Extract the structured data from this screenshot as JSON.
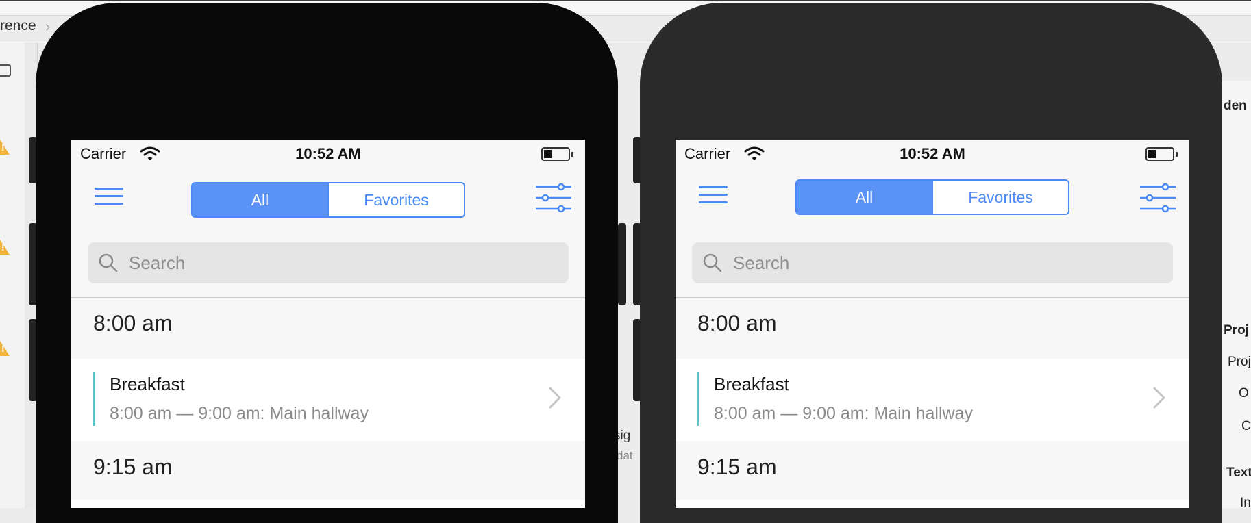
{
  "xcode": {
    "breadcrumb_text": "rence",
    "right_panel": {
      "items": [
        "den",
        "Proj",
        "Proj",
        "O",
        "C",
        "Text",
        "In"
      ]
    },
    "mid_text": {
      "line1": "sig",
      "line2": "dat"
    }
  },
  "phones": [
    {
      "status": {
        "carrier": "Carrier",
        "time": "10:52 AM"
      },
      "segmented": {
        "all_label": "All",
        "favorites_label": "Favorites",
        "selected": "All"
      },
      "search": {
        "placeholder": "Search"
      },
      "sections": [
        {
          "time": "8:00 am",
          "events": [
            {
              "title": "Breakfast",
              "detail": "8:00 am — 9:00 am: Main hallway"
            }
          ]
        },
        {
          "time": "9:15 am",
          "events": []
        }
      ]
    },
    {
      "status": {
        "carrier": "Carrier",
        "time": "10:52 AM"
      },
      "segmented": {
        "all_label": "All",
        "favorites_label": "Favorites",
        "selected": "All"
      },
      "search": {
        "placeholder": "Search"
      },
      "sections": [
        {
          "time": "8:00 am",
          "events": [
            {
              "title": "Breakfast",
              "detail": "8:00 am — 9:00 am: Main hallway"
            }
          ]
        },
        {
          "time": "9:15 am",
          "events": []
        }
      ]
    }
  ],
  "colors": {
    "accent": "#4c8bf5",
    "event_bar": "#5bc5c6",
    "device_dark": "#090909",
    "device_gray": "#2a2a2a"
  },
  "icons": [
    "wifi-icon",
    "battery-icon",
    "hamburger-menu-icon",
    "filter-sliders-icon",
    "search-icon",
    "chevron-right-icon",
    "warning-icon",
    "document-icon"
  ]
}
